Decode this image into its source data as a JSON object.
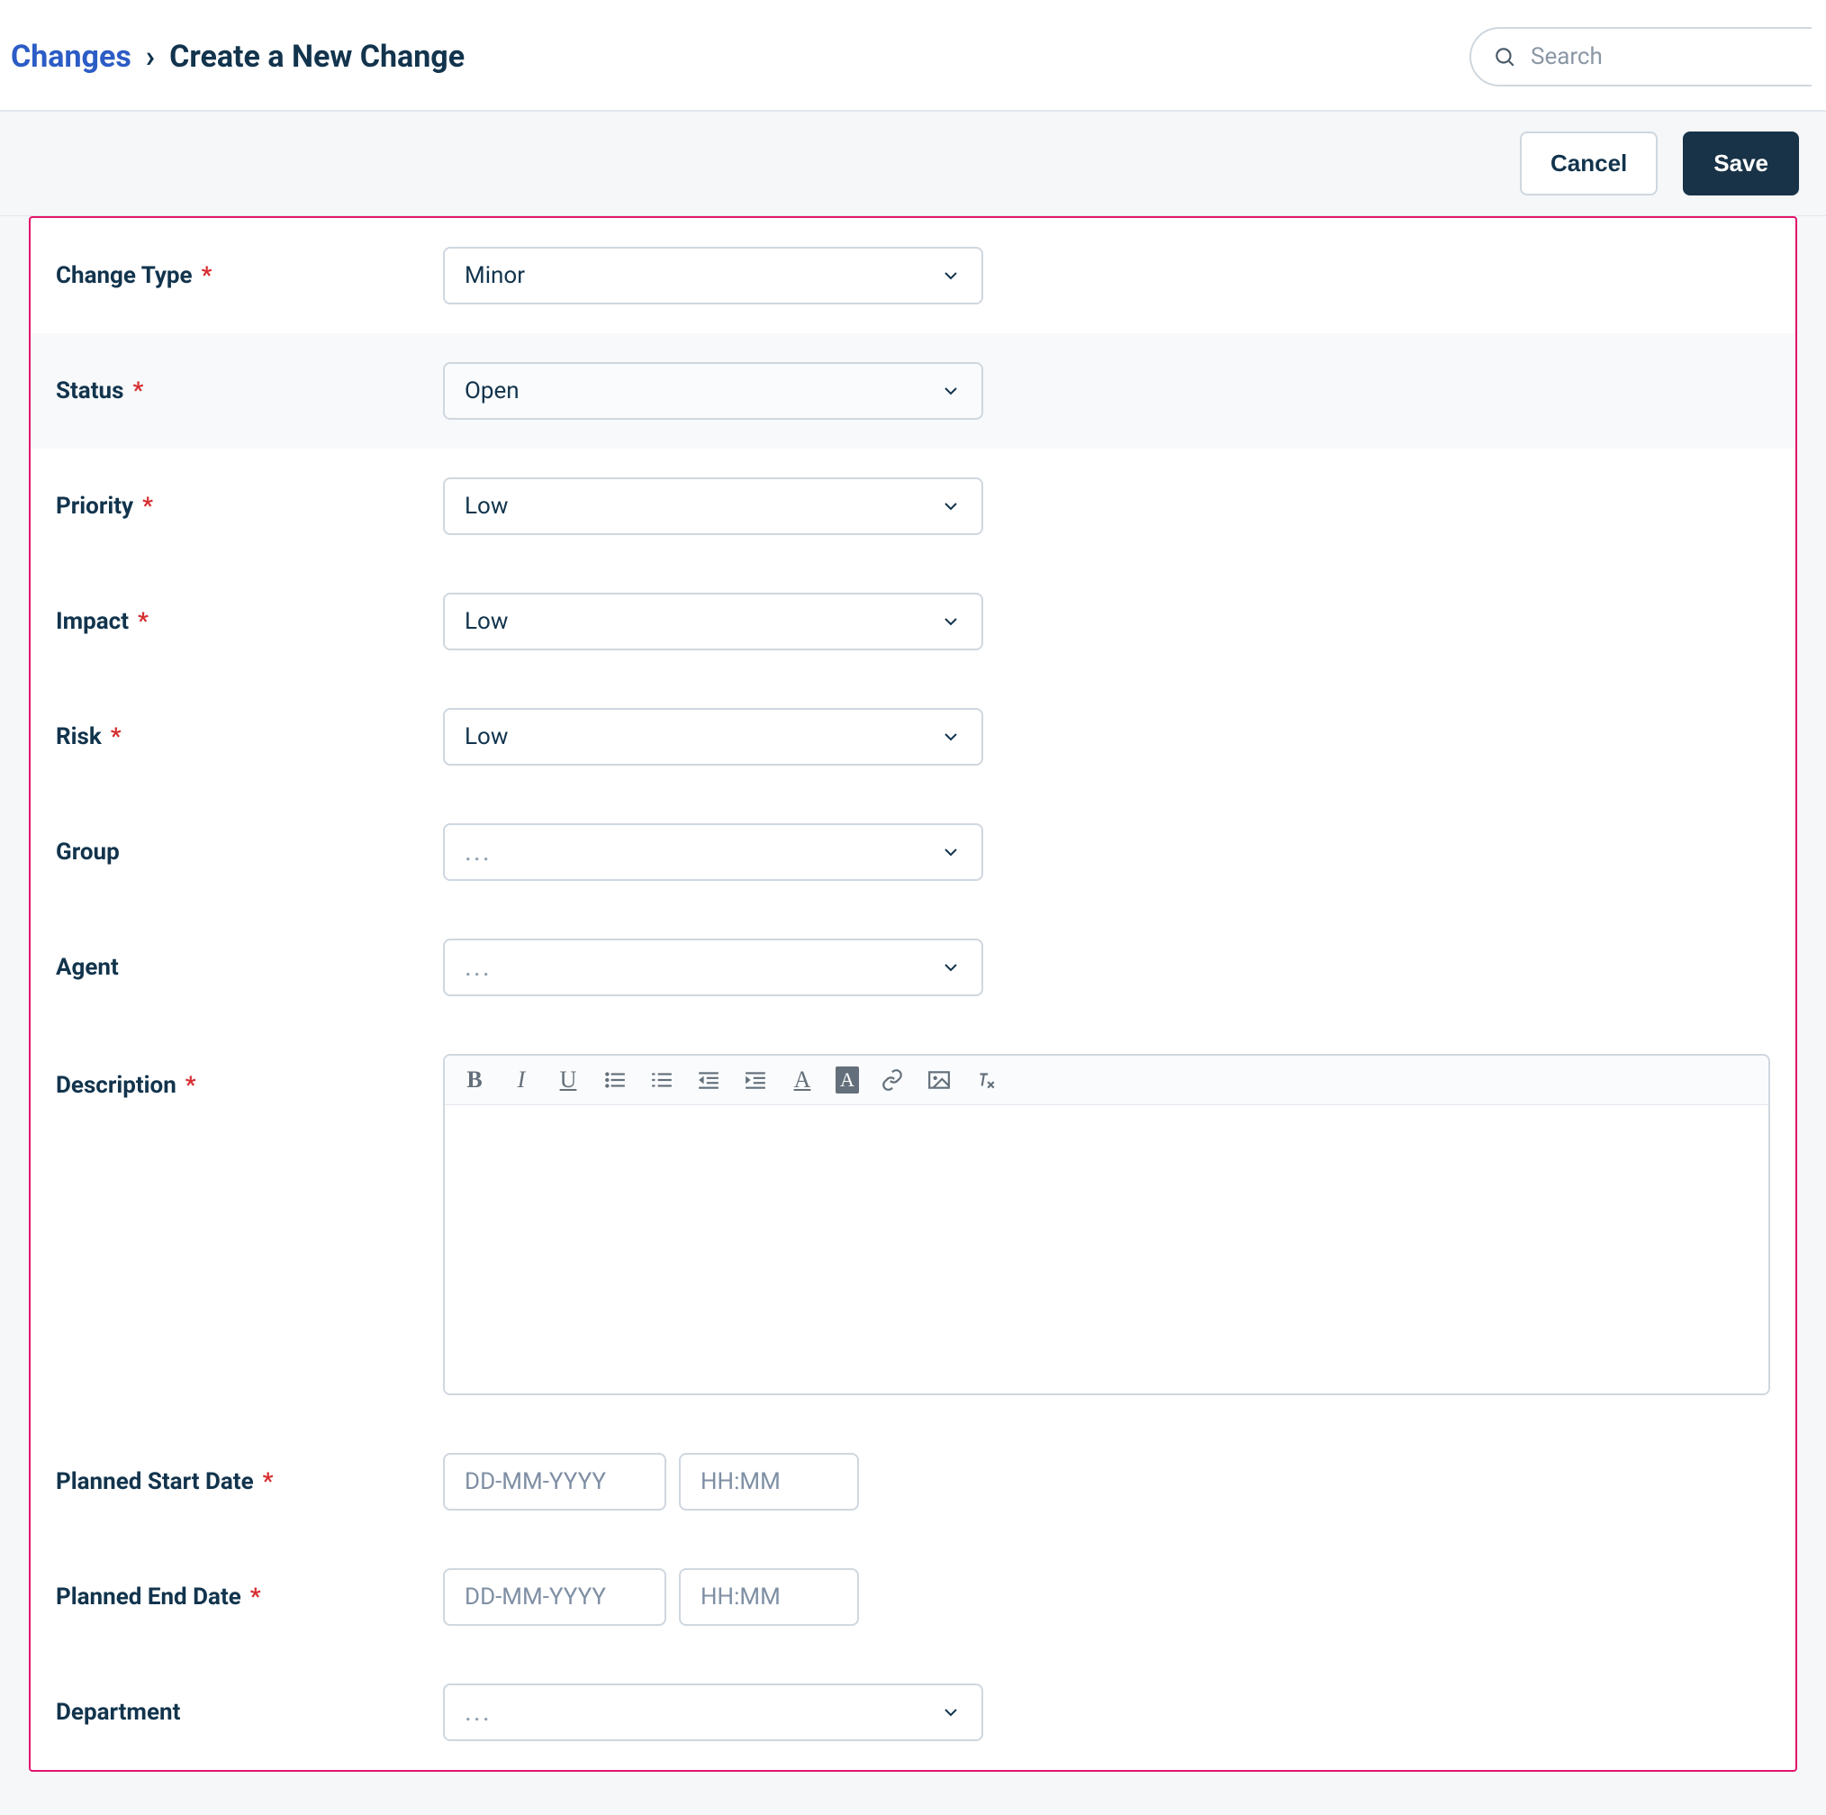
{
  "header": {
    "breadcrumb_root": "Changes",
    "breadcrumb_current": "Create a New Change",
    "search_placeholder": "Search"
  },
  "actions": {
    "cancel": "Cancel",
    "save": "Save"
  },
  "form": {
    "change_type": {
      "label": "Change Type",
      "value": "Minor",
      "required": true
    },
    "status": {
      "label": "Status",
      "value": "Open",
      "required": true
    },
    "priority": {
      "label": "Priority",
      "value": "Low",
      "required": true
    },
    "impact": {
      "label": "Impact",
      "value": "Low",
      "required": true
    },
    "risk": {
      "label": "Risk",
      "value": "Low",
      "required": true
    },
    "group": {
      "label": "Group",
      "value": "",
      "placeholder": "...",
      "required": false
    },
    "agent": {
      "label": "Agent",
      "value": "",
      "placeholder": "...",
      "required": false
    },
    "description": {
      "label": "Description",
      "required": true
    },
    "planned_start": {
      "label": "Planned Start Date",
      "date_ph": "DD-MM-YYYY",
      "time_ph": "HH:MM",
      "required": true
    },
    "planned_end": {
      "label": "Planned End Date",
      "date_ph": "DD-MM-YYYY",
      "time_ph": "HH:MM",
      "required": true
    },
    "department": {
      "label": "Department",
      "value": "",
      "placeholder": "...",
      "required": false
    }
  }
}
